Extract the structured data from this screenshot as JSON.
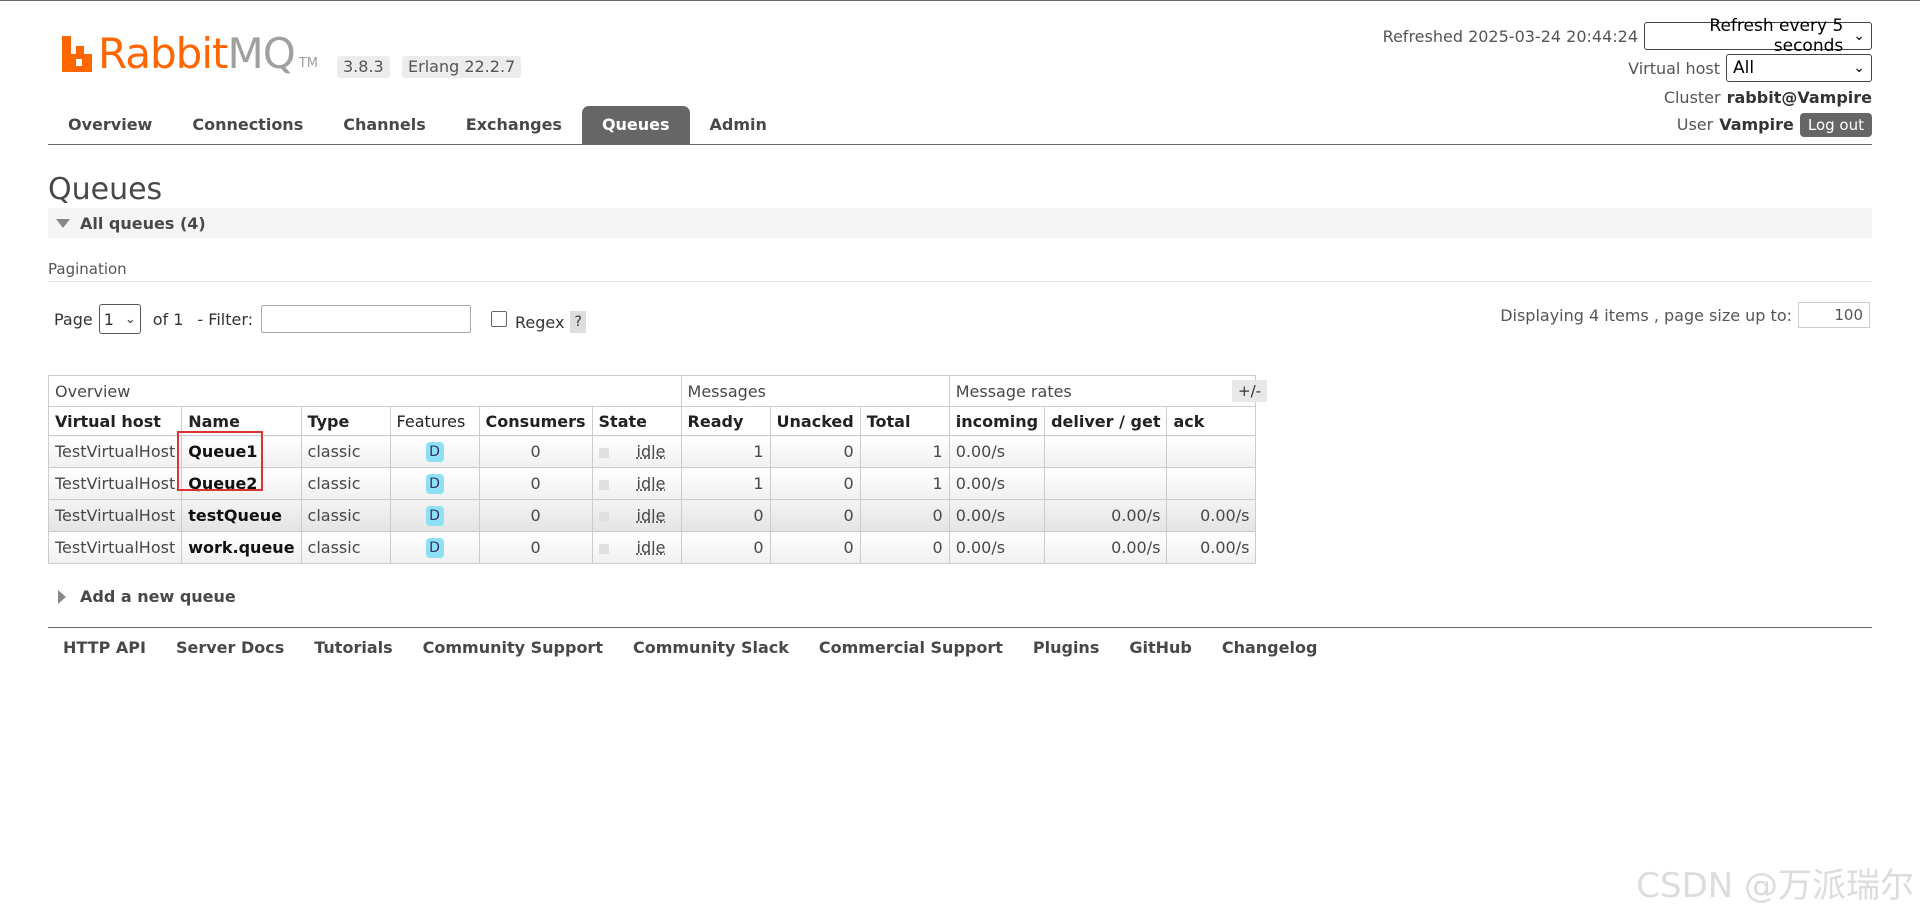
{
  "header": {
    "logo_rabbit": "Rabbit",
    "logo_mq": "MQ",
    "logo_tm": "TM",
    "version": "3.8.3",
    "erlang": "Erlang 22.2.7",
    "refreshed_label": "Refreshed 2025-03-24 20:44:24",
    "refresh_select": "Refresh every 5 seconds",
    "vhost_label": "Virtual host",
    "vhost_select": "All",
    "cluster_label": "Cluster",
    "cluster_value": "rabbit@Vampire",
    "user_label": "User",
    "user_value": "Vampire",
    "logout_label": "Log out"
  },
  "nav": {
    "tabs": [
      "Overview",
      "Connections",
      "Channels",
      "Exchanges",
      "Queues",
      "Admin"
    ],
    "active": "Queues"
  },
  "page": {
    "title": "Queues",
    "section": "All queues (4)"
  },
  "pagination": {
    "label": "Pagination",
    "page_label": "Page",
    "page_value": "1",
    "of_label": "of 1",
    "filter_label": "- Filter:",
    "filter_value": "",
    "regex_label": "Regex",
    "help": "?",
    "displaying": "Displaying 4 items , page size up to:",
    "page_size": "100"
  },
  "table": {
    "groups": [
      "Overview",
      "Messages",
      "Message rates"
    ],
    "toggle": "+/-",
    "columns": [
      "Virtual host",
      "Name",
      "Type",
      "Features",
      "Consumers",
      "State",
      "Ready",
      "Unacked",
      "Total",
      "incoming",
      "deliver / get",
      "ack"
    ],
    "rows": [
      {
        "vhost": "TestVirtualHost",
        "name": "Queue1",
        "type": "classic",
        "feature": "D",
        "consumers": "0",
        "state": "idle",
        "ready": "1",
        "unacked": "0",
        "total": "1",
        "incoming": "0.00/s",
        "deliver": "",
        "ack": ""
      },
      {
        "vhost": "TestVirtualHost",
        "name": "Queue2",
        "type": "classic",
        "feature": "D",
        "consumers": "0",
        "state": "idle",
        "ready": "1",
        "unacked": "0",
        "total": "1",
        "incoming": "0.00/s",
        "deliver": "",
        "ack": ""
      },
      {
        "vhost": "TestVirtualHost",
        "name": "testQueue",
        "type": "classic",
        "feature": "D",
        "consumers": "0",
        "state": "idle",
        "ready": "0",
        "unacked": "0",
        "total": "0",
        "incoming": "0.00/s",
        "deliver": "0.00/s",
        "ack": "0.00/s"
      },
      {
        "vhost": "TestVirtualHost",
        "name": "work.queue",
        "type": "classic",
        "feature": "D",
        "consumers": "0",
        "state": "idle",
        "ready": "0",
        "unacked": "0",
        "total": "0",
        "incoming": "0.00/s",
        "deliver": "0.00/s",
        "ack": "0.00/s"
      }
    ]
  },
  "add_queue": "Add a new queue",
  "footer": [
    "HTTP API",
    "Server Docs",
    "Tutorials",
    "Community Support",
    "Community Slack",
    "Commercial Support",
    "Plugins",
    "GitHub",
    "Changelog"
  ],
  "watermark": "CSDN @万派瑞尔",
  "colors": {
    "brand": "#ff6600",
    "nav_active": "#666666",
    "feature_badge": "#8ee0f5",
    "highlight_box": "#dd3333"
  }
}
